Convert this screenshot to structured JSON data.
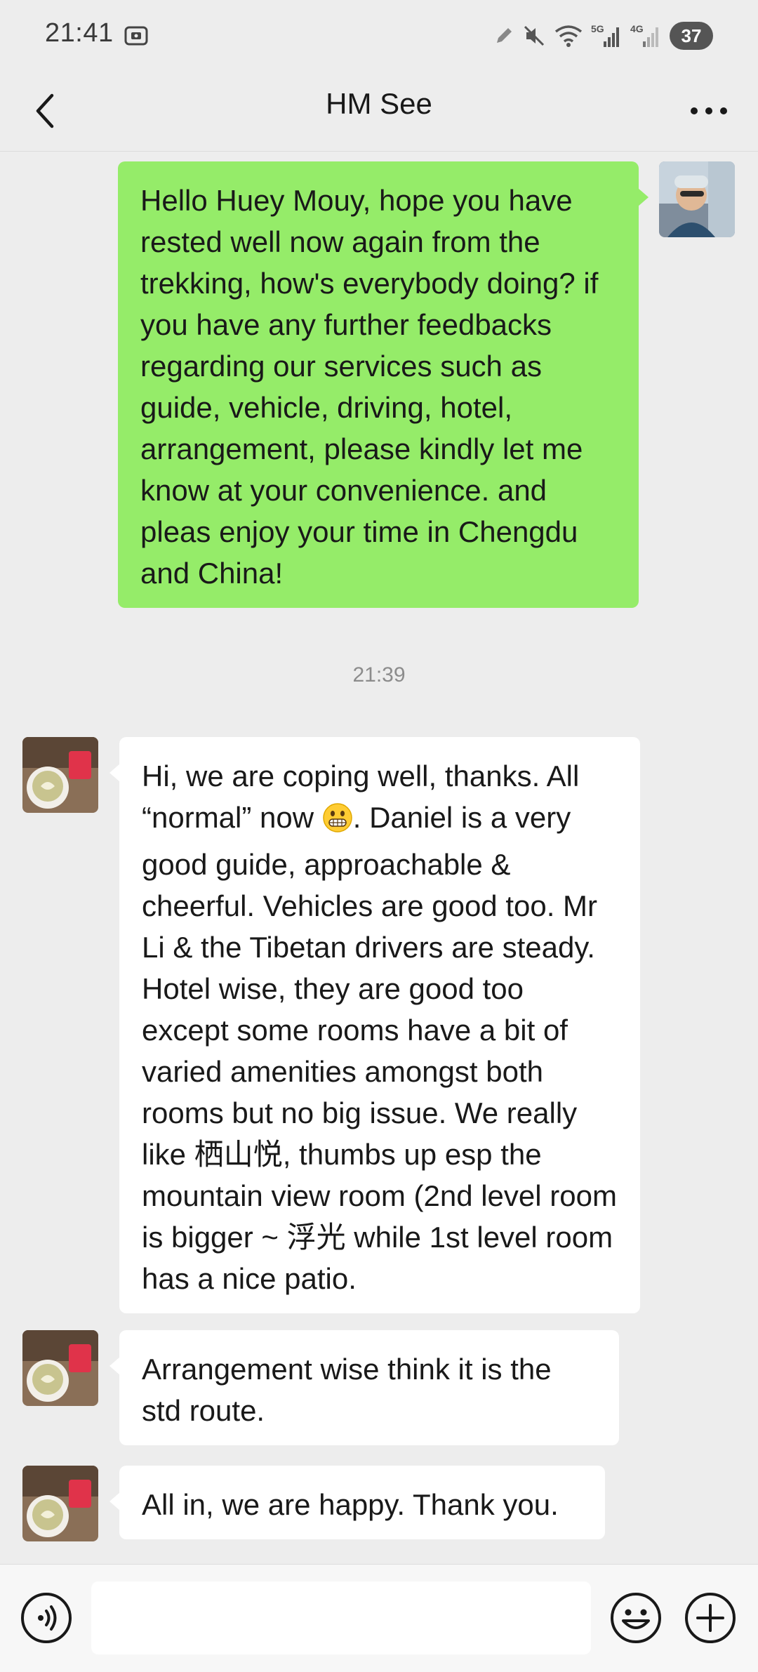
{
  "status_bar": {
    "time": "21:41",
    "network_5g": "5G",
    "network_4g": "4G",
    "battery": "37",
    "icons": [
      "screenshot-icon",
      "pen-icon",
      "mute-icon",
      "wifi-icon",
      "signal-5g-icon",
      "signal-4g-icon",
      "battery-icon"
    ]
  },
  "header": {
    "title": "HM See",
    "back_icon": "chevron-left-icon",
    "more_icon": "more-dots-icon"
  },
  "messages": [
    {
      "side": "sent",
      "text": "Hello Huey Mouy, hope you have rested well now again from the trekking, how's everybody doing? if you have any further feedbacks regarding our services such as guide, vehicle, driving, hotel, arrangement, please kindly let me know at your convenience. and pleas enjoy your time in Chengdu and China!"
    },
    {
      "timestamp": "21:39"
    },
    {
      "side": "received",
      "text_before_emoji": "Hi, we are coping well, thanks. All “normal” now ",
      "emoji": "grimacing-face",
      "text_after_emoji": ". Daniel is a very good guide, approachable & cheerful. Vehicles are good too. Mr Li & the Tibetan drivers are steady. Hotel wise, they are good too except some rooms have a bit of varied amenities amongst both rooms but no big issue. We really like 栖山悦, thumbs up esp the mountain view room (2nd level room is bigger ~ 浮光 while 1st level room has a nice patio."
    },
    {
      "side": "received",
      "text": "Arrangement wise think it is the std route."
    },
    {
      "side": "received",
      "text": "All in, we are happy. Thank you."
    }
  ],
  "input_bar": {
    "placeholder": "",
    "value": "",
    "voice_icon": "voice-icon",
    "emoji_icon": "emoji-icon",
    "plus_icon": "plus-icon"
  },
  "colors": {
    "background": "#ededed",
    "sent_bubble": "#95ec69",
    "received_bubble": "#ffffff",
    "timestamp": "#8c8c8c"
  }
}
